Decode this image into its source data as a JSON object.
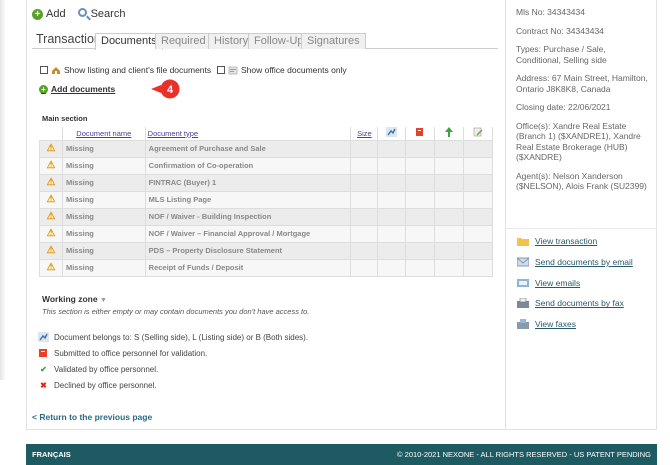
{
  "toolbar": {
    "add_label": "Add",
    "search_label": "Search"
  },
  "tabs": {
    "title": "Transaction",
    "items": [
      "Documents",
      "Required",
      "History",
      "Follow-Up",
      "Signatures"
    ],
    "active": "Documents"
  },
  "filters": {
    "listing_label": "Show listing and client's file documents",
    "office_label": "Show office documents only"
  },
  "add_documents_label": "Add documents",
  "step_badge": "4",
  "main_section": {
    "title": "Main section",
    "columns": [
      "Document name",
      "Document type",
      "Size"
    ],
    "rows": [
      {
        "status": "Missing",
        "type": "Agreement of Purchase and Sale"
      },
      {
        "status": "Missing",
        "type": "Confirmation of Co-operation"
      },
      {
        "status": "Missing",
        "type": "FINTRAC (Buyer) 1"
      },
      {
        "status": "Missing",
        "type": "MLS Listing Page"
      },
      {
        "status": "Missing",
        "type": "NOF / Waiver - Building Inspection"
      },
      {
        "status": "Missing",
        "type": "NOF / Waiver – Financial Approval / Mortgage"
      },
      {
        "status": "Missing",
        "type": "PDS – Property Disclosure Statement"
      },
      {
        "status": "Missing",
        "type": "Receipt of Funds / Deposit"
      }
    ]
  },
  "working_zone": {
    "title": "Working zone",
    "note": "This section is either empty or may contain documents you don't have access to."
  },
  "legend": [
    {
      "icon": "side-icon",
      "text": "Document belongs to: S (Selling side), L (Listing side) or B (Both sides)."
    },
    {
      "icon": "submitted-icon",
      "text": "Submitted to office personnel for validation."
    },
    {
      "icon": "check-icon",
      "text": "Validated by office personnel."
    },
    {
      "icon": "x-icon",
      "text": "Declined by office personnel."
    }
  ],
  "return_link": "< Return to the previous page",
  "info": {
    "mls": "Mls No:  34343434",
    "contract": "Contract No:  34343434",
    "types": "Types: Purchase / Sale, Conditional, Selling side",
    "address": "Address: 67 Main Street, Hamilton, Ontario J8K8K8, Canada",
    "closing": "Closing date: 22/06/2021",
    "offices": "Office(s): Xandre Real Estate (Branch 1) ($XANDRE1), Xandre Real Estate Brokerage (HUB) ($XANDRE)",
    "agents": "Agent(s): Nelson Xanderson ($NELSON), Alois Frank (SU2399)"
  },
  "actions": [
    "View transaction",
    "Send documents by email",
    "View emails",
    "Send documents by fax",
    "View faxes"
  ],
  "footer": {
    "lang": "FRANÇAIS",
    "copyright": "© 2010-2021 NEXONE - ALL RIGHTS RESERVED - US PATENT PENDING"
  },
  "colors": {
    "accent": "#1d5a62",
    "link": "#2a5a6a",
    "badge": "#e8312a",
    "warning": "#e69b00"
  }
}
